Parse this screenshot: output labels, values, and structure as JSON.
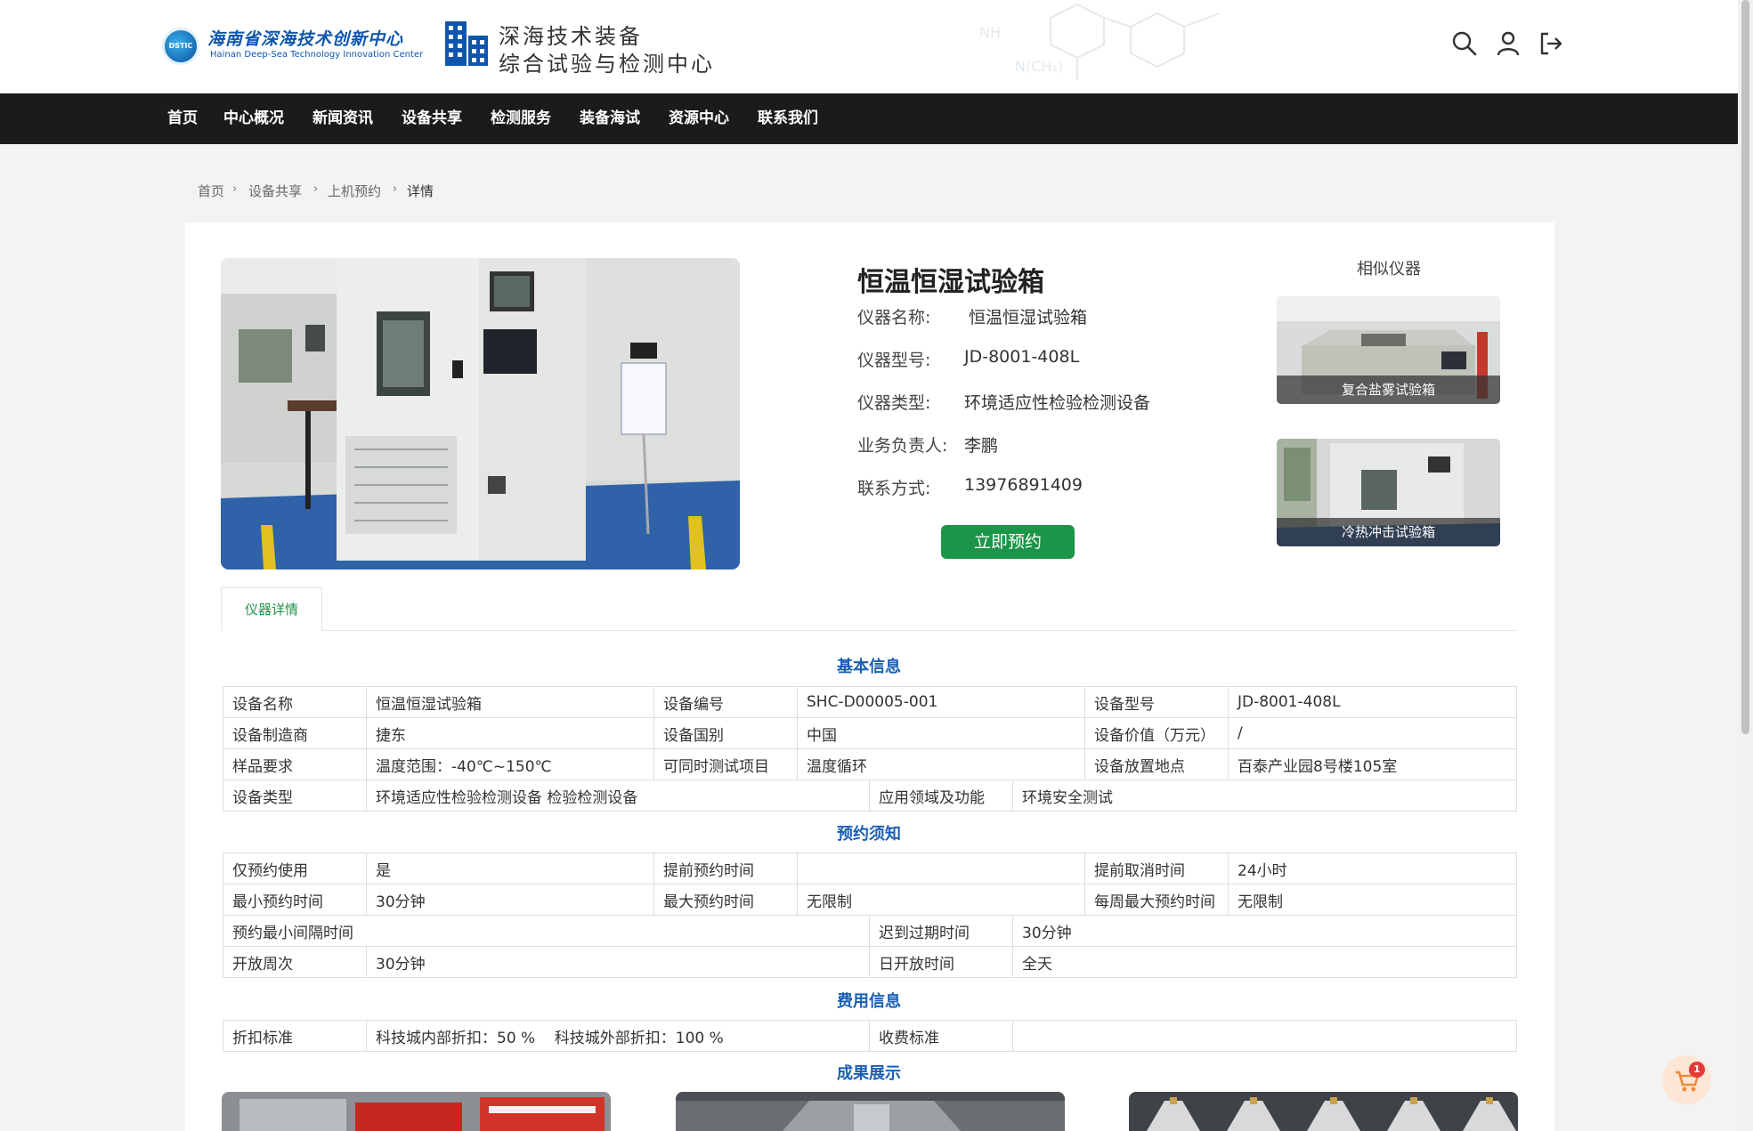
{
  "header": {
    "logo_abbr": "DSTIC",
    "logo_cn": "海南省深海技术创新中心",
    "logo_en": "Hainan Deep-Sea Technology Innovation Center",
    "center_line1": "深海技术装备",
    "center_line2": "综合试验与检测中心",
    "bg_formula_1": "NH",
    "bg_formula_2": "N(CH₃)"
  },
  "nav": [
    "首页",
    "中心概况",
    "新闻资讯",
    "设备共享",
    "检测服务",
    "装备海试",
    "资源中心",
    "联系我们"
  ],
  "breadcrumb": [
    "首页",
    "设备共享",
    "上机预约",
    "详情"
  ],
  "device": {
    "title": "恒温恒湿试验箱",
    "name_label": "仪器名称:",
    "name": "恒温恒湿试验箱",
    "model_label": "仪器型号:",
    "model": "JD-8001-408L",
    "type_label": "仪器类型:",
    "type": "环境适应性检验检测设备",
    "owner_label": "业务负责人:",
    "owner": "李鹏",
    "contact_label": "联系方式:",
    "contact": "13976891409",
    "book_label": "立即预约"
  },
  "similar": {
    "title": "相似仪器",
    "items": [
      "复合盐雾试验箱",
      "冷热冲击试验箱"
    ]
  },
  "tab": "仪器详情",
  "basic": {
    "title": "基本信息",
    "r1": [
      "设备名称",
      "恒温恒湿试验箱",
      "设备编号",
      "SHC-D00005-001",
      "设备型号",
      "JD-8001-408L"
    ],
    "r2": [
      "设备制造商",
      "捷东",
      "设备国别",
      "中国",
      "设备价值（万元）",
      "/"
    ],
    "r3": [
      "样品要求",
      "温度范围：-40℃~150℃",
      "可同时测试项目",
      "温度循环",
      "设备放置地点",
      "百泰产业园8号楼105室"
    ],
    "r4": [
      "设备类型",
      "环境适应性检验检测设备 检验检测设备",
      "应用领域及功能",
      "环境安全测试"
    ]
  },
  "booking": {
    "title": "预约须知",
    "r1": [
      "仅预约使用",
      "是",
      "提前预约时间",
      "",
      "提前取消时间",
      "24小时"
    ],
    "r2": [
      "最小预约时间",
      "30分钟",
      "最大预约时间",
      "无限制",
      "每周最大预约时间",
      "无限制"
    ],
    "r3": [
      "预约最小间隔时间",
      "迟到过期时间",
      "30分钟"
    ],
    "r4": [
      "开放周次",
      "30分钟",
      "日开放时间",
      "全天"
    ]
  },
  "fee": {
    "title": "费用信息",
    "r1": [
      "折扣标准",
      "科技城内部折扣：50 %    科技城外部折扣：100 %",
      "收费标准",
      ""
    ]
  },
  "results": {
    "title": "成果展示"
  },
  "cart": {
    "count": "1"
  },
  "colors": {
    "nav_bg": "#1b1b1b",
    "accent_green": "#1c9548",
    "section_blue": "#1a5fb4",
    "logo_blue": "#0d56ad"
  }
}
